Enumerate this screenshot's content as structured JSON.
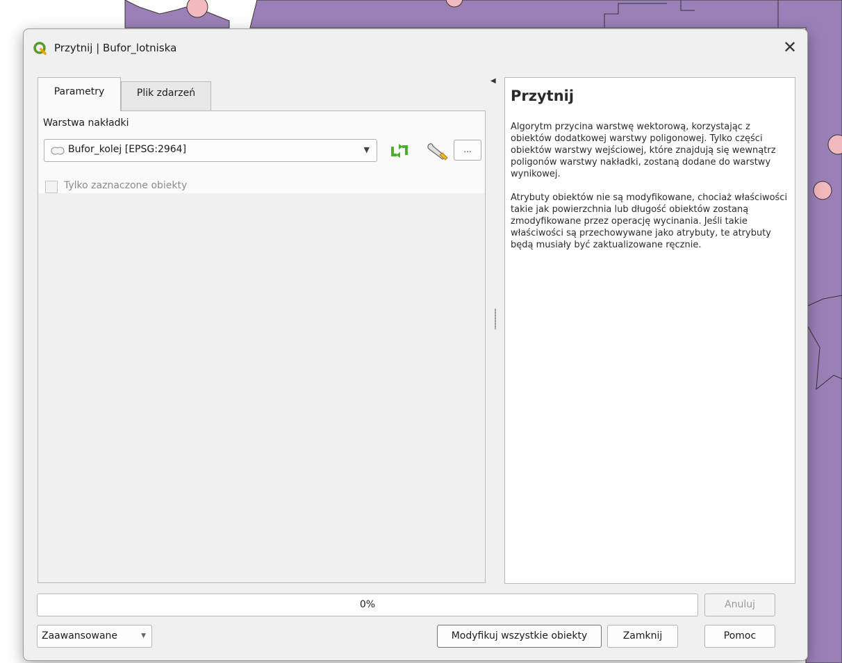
{
  "dialog": {
    "title": "Przytnij | Bufor_lotniska",
    "app_icon": "qgis-logo-icon",
    "close_glyph": "✕"
  },
  "tabs": [
    {
      "label": "Parametry",
      "active": true
    },
    {
      "label": "Plik zdarzeń",
      "active": false
    }
  ],
  "parameters": {
    "overlay_label": "Warstwa nakładki",
    "overlay_value": "Bufor_kolej [EPSG:2964]",
    "overlay_icon": "polygon-layer-icon",
    "iterate_icon": "iterate-icon",
    "settings_icon": "wrench-icon",
    "more_label": "...",
    "selected_only_label": "Tylko zaznaczone obiekty",
    "selected_only_checked": false
  },
  "help": {
    "title": "Przytnij",
    "paragraph1": "Algorytm przycina warstwę wektorową, korzystając z obiektów dodatkowej warstwy poligonowej. Tylko części obiektów warstwy wejściowej, które znajdują się wewnątrz poligonów warstwy nakładki, zostaną dodane do warstwy wynikowej.",
    "paragraph2": "Atrybuty obiektów nie są modyfikowane, chociaż właściwości takie jak powierzchnia lub długość obiektów zostaną zmodyfikowane przez operację wycinania. Jeśli takie właściwości są przechowywane jako atrybuty, te atrybuty będą musiały być zaktualizowane ręcznie."
  },
  "progress": {
    "value": 0,
    "label": "0%"
  },
  "buttons": {
    "cancel": "Anuluj",
    "advanced": "Zaawansowane",
    "modify_all": "Modyfikuj wszystkie obiekty",
    "close": "Zamknij",
    "help": "Pomoc"
  },
  "colors": {
    "map_polygon": "#9b80b8",
    "map_point": "#f2b9be",
    "accent": "#3a7bd5"
  }
}
